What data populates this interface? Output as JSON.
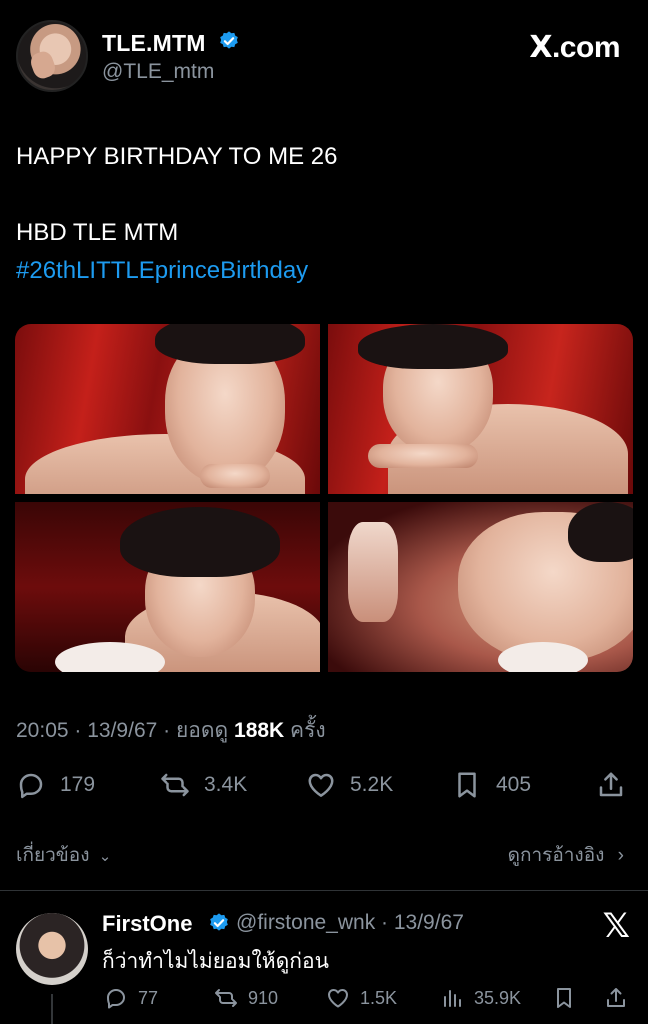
{
  "author": {
    "display_name": "TLE.MTM",
    "handle": "@TLE_mtm",
    "verified": true
  },
  "brand": {
    "label": ".com",
    "mark": "X"
  },
  "tweet": {
    "line1": "HAPPY BIRTHDAY TO ME 26",
    "line2": "HBD TLE MTM",
    "hashtag": "#26thLITTLEprinceBirthday"
  },
  "meta": {
    "time": "20:05",
    "sep1": " · ",
    "date": "13/9/67",
    "sep2": " · ",
    "views_label": "ยอดดู ",
    "views": "188K",
    "views_suffix": " ครั้ง"
  },
  "actions": {
    "replies": "179",
    "reposts": "3.4K",
    "likes": "5.2K",
    "bookmarks": "405"
  },
  "related": {
    "label": "เกี่ยวข้อง",
    "quotes_label": "ดูการอ้างอิง"
  },
  "reply": {
    "display_name": "FirstOne",
    "handle_date": "@firstone_wnk · 13/9/67",
    "text": "ก็ว่าทำไมไม่ยอมให้ดูก่อน",
    "replies": "77",
    "reposts": "910",
    "likes": "1.5K",
    "views": "35.9K"
  },
  "colors": {
    "background": "#000000",
    "accent": "#1d9bf0",
    "muted": "#8b949e"
  },
  "icons": [
    "verified-badge-icon",
    "x-logo-icon",
    "reply-icon",
    "repost-icon",
    "like-icon",
    "bookmark-icon",
    "share-icon",
    "views-icon",
    "chevron-down-icon",
    "chevron-right-icon"
  ]
}
